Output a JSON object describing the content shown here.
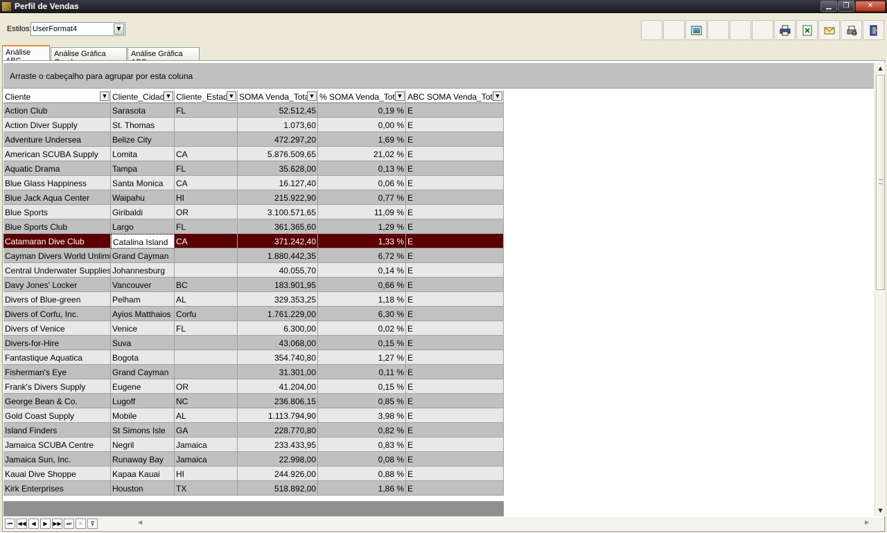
{
  "window": {
    "title": "Perfil de Vendas",
    "min_symbol": "▁",
    "max_symbol": "❐",
    "close_symbol": "✕"
  },
  "toolbar": {
    "estilos_label": "Estilos:",
    "estilos_value": "UserFormat4",
    "dropdown_arrow": "▼"
  },
  "tabs": [
    {
      "label": "Análise ABC",
      "active": true
    },
    {
      "label": "Análise Gráfica Geral",
      "active": false
    },
    {
      "label": "Análise Gráfica ABC",
      "active": false
    }
  ],
  "grid": {
    "group_hint": "Arraste o cabeçalho para agrupar por esta coluna",
    "filter_symbol": "▼",
    "columns": [
      "Cliente",
      "Cliente_Cidade",
      "Cliente_Estado",
      "SOMA Venda_Total",
      "% SOMA Venda_Total",
      "ABC SOMA Venda_Total"
    ],
    "rows": [
      [
        "Action Club",
        "Sarasota",
        "FL",
        "52.512,45",
        "0,19 %",
        "E"
      ],
      [
        "Action Diver Supply",
        "St. Thomas",
        "",
        "1.073,60",
        "0,00 %",
        "E"
      ],
      [
        "Adventure Undersea",
        "Belize City",
        "",
        "472.297,20",
        "1,69 %",
        "E"
      ],
      [
        "American SCUBA Supply",
        "Lomita",
        "CA",
        "5.876.509,65",
        "21,02 %",
        "E"
      ],
      [
        "Aquatic Drama",
        "Tampa",
        "FL",
        "35.628,00",
        "0,13 %",
        "E"
      ],
      [
        "Blue Glass Happiness",
        "Santa Monica",
        "CA",
        "16.127,40",
        "0,06 %",
        "E"
      ],
      [
        "Blue Jack Aqua Center",
        "Waipahu",
        "HI",
        "215.922,90",
        "0,77 %",
        "E"
      ],
      [
        "Blue Sports",
        "Giribaldi",
        "OR",
        "3.100.571,65",
        "11,09 %",
        "E"
      ],
      [
        "Blue Sports Club",
        "Largo",
        "FL",
        "361.365,60",
        "1,29 %",
        "E"
      ],
      [
        "Catamaran Dive Club",
        "Catalina Island",
        "CA",
        "371.242,40",
        "1,33 %",
        "E"
      ],
      [
        "Cayman Divers World Unlimited",
        "Grand Cayman",
        "",
        "1.880.442,35",
        "6,72 %",
        "E"
      ],
      [
        "Central Underwater Supplies",
        "Johannesburg",
        "",
        "40.055,70",
        "0,14 %",
        "E"
      ],
      [
        "Davy Jones' Locker",
        "Vancouver",
        "BC",
        "183.901,95",
        "0,66 %",
        "E"
      ],
      [
        "Divers of Blue-green",
        "Pelham",
        "AL",
        "329.353,25",
        "1,18 %",
        "E"
      ],
      [
        "Divers of Corfu, Inc.",
        "Ayios Matthaios",
        "Corfu",
        "1.761.229,00",
        "6,30 %",
        "E"
      ],
      [
        "Divers of Venice",
        "Venice",
        "FL",
        "6.300,00",
        "0,02 %",
        "E"
      ],
      [
        "Divers-for-Hire",
        "Suva",
        "",
        "43.068,00",
        "0,15 %",
        "E"
      ],
      [
        "Fantastique Aquatica",
        "Bogota",
        "",
        "354.740,80",
        "1,27 %",
        "E"
      ],
      [
        "Fisherman's Eye",
        "Grand Cayman",
        "",
        "31.301,00",
        "0,11 %",
        "E"
      ],
      [
        "Frank's Divers Supply",
        "Eugene",
        "OR",
        "41.204,00",
        "0,15 %",
        "E"
      ],
      [
        "George Bean & Co.",
        "Lugoff",
        "NC",
        "236.806,15",
        "0,85 %",
        "E"
      ],
      [
        "Gold Coast Supply",
        "Mobile",
        "AL",
        "1.113.794,90",
        "3,98 %",
        "E"
      ],
      [
        "Island Finders",
        "St Simons Isle",
        "GA",
        "228.770,80",
        "0,82 %",
        "E"
      ],
      [
        "Jamaica SCUBA Centre",
        "Negril",
        "Jamaica",
        "233.433,95",
        "0,83 %",
        "E"
      ],
      [
        "Jamaica Sun, Inc.",
        "Runaway Bay",
        "Jamaica",
        "22.998,00",
        "0,08 %",
        "E"
      ],
      [
        "Kauai Dive Shoppe",
        "Kapaa Kauai",
        "HI",
        "244.926,00",
        "0,88 %",
        "E"
      ],
      [
        "Kirk Enterprises",
        "Houston",
        "TX",
        "518.892,00",
        "1,86 %",
        "E"
      ]
    ],
    "selected_row": 9
  },
  "navigator": {
    "first": "⏮",
    "prev_page": "◀◀",
    "prev": "◀",
    "next": "▶",
    "next_page": "▶▶",
    "last": "⏭",
    "cancel": "✕",
    "filter": "⊽"
  },
  "scroll": {
    "up": "▲",
    "down": "▼",
    "left": "◀",
    "right": "▶"
  }
}
